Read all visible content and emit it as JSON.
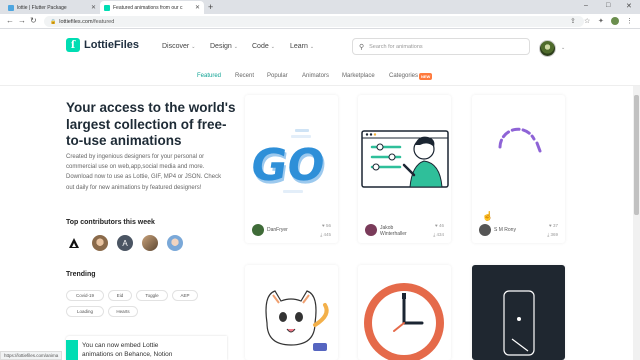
{
  "browser": {
    "tabs": [
      {
        "title": "lottie | Flutter Package",
        "active": false
      },
      {
        "title": "Featured animations from our c",
        "active": true
      }
    ],
    "url": "lottiefiles.com/featured",
    "url_host": "lottiefiles.com",
    "url_path": "/featured",
    "status_link": "https://lottiefiles.com/anima"
  },
  "header": {
    "logo": "LottieFiles",
    "nav": [
      {
        "label": "Discover"
      },
      {
        "label": "Design"
      },
      {
        "label": "Code"
      },
      {
        "label": "Learn"
      }
    ],
    "search_placeholder": "Search for animations"
  },
  "subnav": {
    "items": [
      "Featured",
      "Recent",
      "Popular",
      "Animators",
      "Marketplace",
      "Categories"
    ],
    "active": "Featured",
    "badge": "NEW"
  },
  "hero": {
    "title": "Your access to the world's largest collection of free-to-use animations",
    "description": "Created by ingenious designers for your personal or commercial use on web,app,social media and more. Download now to use as Lottie, GIF, MP4 or JSON. Check out daily for new animations by featured designers!"
  },
  "contributors": {
    "title": "Top contributors this week",
    "count": 5
  },
  "trending": {
    "title": "Trending",
    "tags": [
      "Covid-19",
      "Eid",
      "Toggle",
      "AEP",
      "Loading",
      "Hearts"
    ]
  },
  "promo": {
    "text_line1": "You can now embed Lottie",
    "text_line2": "animations on Behance, Notion"
  },
  "cards": [
    {
      "author": "DanFryer",
      "likes": "56",
      "downloads": "445"
    },
    {
      "author": "Jakob Winterhaller",
      "likes": "46",
      "downloads": "434"
    },
    {
      "author": "S M Rony",
      "likes": "37",
      "downloads": "369"
    }
  ],
  "colors": {
    "brand": "#00ddb3",
    "active_tab": "#0fa394",
    "badge": "#ff7a3d"
  }
}
